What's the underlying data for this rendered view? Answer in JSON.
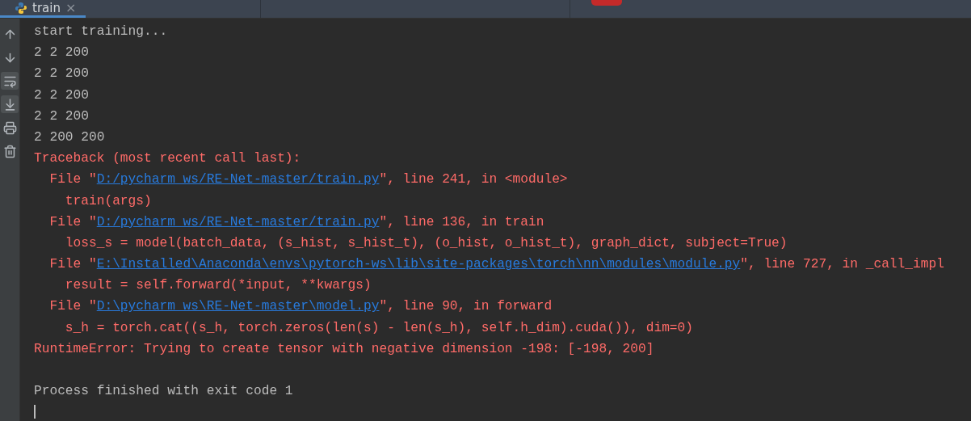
{
  "tabs": [
    {
      "label": "train",
      "selected": true,
      "close": "×"
    }
  ],
  "toolbar": [
    {
      "kind": "up",
      "on": false
    },
    {
      "kind": "down",
      "on": false
    },
    {
      "kind": "wrap",
      "on": true
    },
    {
      "kind": "scroll-end",
      "on": true
    },
    {
      "kind": "print",
      "on": false
    },
    {
      "kind": "trash",
      "on": false
    }
  ],
  "console": {
    "lines": [
      {
        "kind": "output",
        "text": "start training..."
      },
      {
        "kind": "output",
        "text": "2 2 200"
      },
      {
        "kind": "output",
        "text": "2 2 200"
      },
      {
        "kind": "output",
        "text": "2 2 200"
      },
      {
        "kind": "output",
        "text": "2 2 200"
      },
      {
        "kind": "output",
        "text": "2 200 200"
      },
      {
        "kind": "error",
        "text": "Traceback (most recent call last):"
      },
      {
        "kind": "error",
        "prefix": "  File \"",
        "link": "D:/pycharm_ws/RE-Net-master/train.py",
        "suffix": "\", line 241, in <module>"
      },
      {
        "kind": "error",
        "text": "    train(args)"
      },
      {
        "kind": "error",
        "prefix": "  File \"",
        "link": "D:/pycharm_ws/RE-Net-master/train.py",
        "suffix": "\", line 136, in train"
      },
      {
        "kind": "error",
        "text": "    loss_s = model(batch_data, (s_hist, s_hist_t), (o_hist, o_hist_t), graph_dict, subject=True)"
      },
      {
        "kind": "error",
        "prefix": "  File \"",
        "link": "E:\\Installed\\Anaconda\\envs\\pytorch-ws\\lib\\site-packages\\torch\\nn\\modules\\module.py",
        "suffix": "\", line 727, in _call_impl"
      },
      {
        "kind": "error",
        "text": "    result = self.forward(*input, **kwargs)"
      },
      {
        "kind": "error",
        "prefix": "  File \"",
        "link": "D:\\pycharm_ws\\RE-Net-master\\model.py",
        "suffix": "\", line 90, in forward"
      },
      {
        "kind": "error",
        "text": "    s_h = torch.cat((s_h, torch.zeros(len(s) - len(s_h), self.h_dim).cuda()), dim=0)"
      },
      {
        "kind": "error",
        "text": "RuntimeError: Trying to create tensor with negative dimension -198: [-198, 200]"
      },
      {
        "kind": "blank"
      },
      {
        "kind": "output",
        "text": "Process finished with exit code 1"
      },
      {
        "kind": "cursor"
      }
    ]
  }
}
